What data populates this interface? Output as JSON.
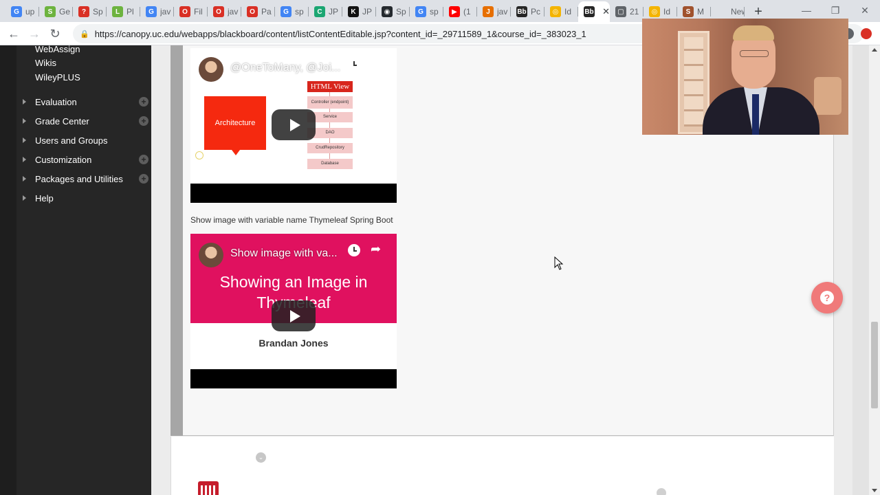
{
  "browser": {
    "tabs": [
      {
        "label": "up",
        "fav": "G",
        "color": "#4285f4"
      },
      {
        "label": "Ge",
        "fav": "S",
        "color": "#6db33f"
      },
      {
        "label": "Sp",
        "fav": "?",
        "color": "#d93025"
      },
      {
        "label": "Pl",
        "fav": "L",
        "color": "#6db33f"
      },
      {
        "label": "jav",
        "fav": "G",
        "color": "#4285f4"
      },
      {
        "label": "Fil",
        "fav": "O",
        "color": "#d93025"
      },
      {
        "label": "jav",
        "fav": "O",
        "color": "#d93025"
      },
      {
        "label": "Pa",
        "fav": "O",
        "color": "#d93025"
      },
      {
        "label": "sp",
        "fav": "G",
        "color": "#4285f4"
      },
      {
        "label": "JP",
        "fav": "C",
        "color": "#1ba672"
      },
      {
        "label": "JP",
        "fav": "K",
        "color": "#111111"
      },
      {
        "label": "Sp",
        "fav": "◉",
        "color": "#24292e"
      },
      {
        "label": "sp",
        "fav": "G",
        "color": "#4285f4"
      },
      {
        "label": "(1",
        "fav": "▶",
        "color": "#ff0000"
      },
      {
        "label": "jav",
        "fav": "J",
        "color": "#e76f00"
      },
      {
        "label": "Pc",
        "fav": "Bb",
        "color": "#262626"
      },
      {
        "label": "Id",
        "fav": "◎",
        "color": "#f4b400"
      },
      {
        "label": "",
        "fav": "Bb",
        "color": "#262626",
        "active": true
      },
      {
        "label": "21",
        "fav": "▢",
        "color": "#5f6368"
      },
      {
        "label": "Id",
        "fav": "◎",
        "color": "#f4b400"
      },
      {
        "label": "M",
        "fav": "S",
        "color": "#a0522d"
      },
      {
        "label": "New T",
        "fav": "",
        "color": "#dee1e6"
      }
    ],
    "active_tab_close": "✕",
    "new_tab": "+",
    "window_controls": {
      "minimize": "—",
      "maximize": "❐",
      "close": "✕"
    },
    "nav": {
      "back": "←",
      "forward": "→",
      "reload": "↻"
    },
    "url": "https://canopy.uc.edu/webapps/blackboard/content/listContentEditable.jsp?content_id=_29711589_1&course_id=_383023_1",
    "lock_icon": "🔒",
    "extensions": [
      {
        "name": "extension-dot-icon",
        "color": "#5f6368"
      },
      {
        "name": "extension-red-icon",
        "color": "#d93025"
      }
    ]
  },
  "sidebar": {
    "plain_links": [
      "WebAssign",
      "Wikis",
      "WileyPLUS"
    ],
    "sections": [
      {
        "label": "Evaluation",
        "has_plus": true
      },
      {
        "label": "Grade Center",
        "has_plus": true
      },
      {
        "label": "Users and Groups",
        "has_plus": false
      },
      {
        "label": "Customization",
        "has_plus": true
      },
      {
        "label": "Packages and Utilities",
        "has_plus": true
      },
      {
        "label": "Help",
        "has_plus": false
      }
    ]
  },
  "content": {
    "video1": {
      "title": "@OneToMany, @Joi...",
      "slide": {
        "box_label": "Architecture",
        "header": "HTML View",
        "layers": [
          "Controller (endpoint)",
          "Service",
          "DAO",
          "CrudRepository",
          "Database"
        ]
      }
    },
    "caption2": "Show image with variable name Thymeleaf Spring Boot",
    "video2": {
      "title": "Show image with va...",
      "slide_title_line1": "Showing an Image in",
      "slide_title_line2": "Thymeleaf",
      "author": "Brandan Jones"
    },
    "help_fab": "?",
    "chevron": "⌄"
  }
}
